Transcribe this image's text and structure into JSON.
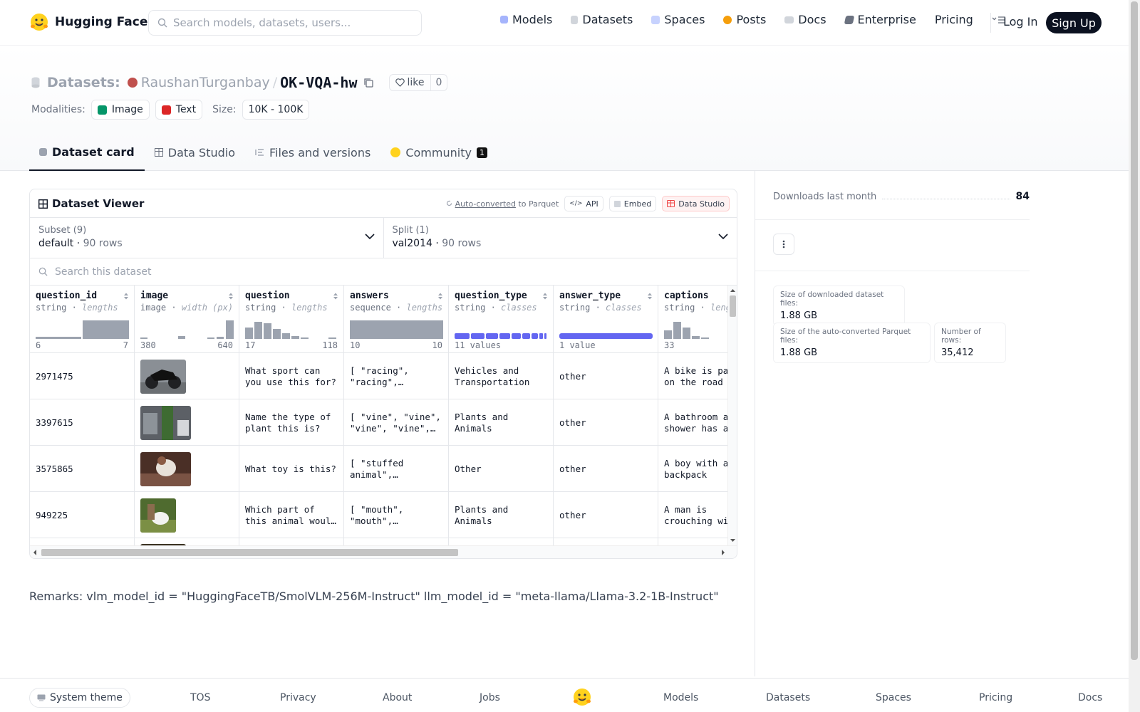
{
  "brand": {
    "name": "Hugging Face"
  },
  "search": {
    "placeholder": "Search models, datasets, users..."
  },
  "nav": {
    "models": "Models",
    "datasets": "Datasets",
    "spaces": "Spaces",
    "posts": "Posts",
    "docs": "Docs",
    "enterprise": "Enterprise",
    "pricing": "Pricing",
    "login": "Log In",
    "signup": "Sign Up"
  },
  "repo": {
    "section": "Datasets:",
    "owner": "RaushanTurganbay",
    "separator": "/",
    "name": "OK-VQA-hw",
    "like_label": "like",
    "like_count": "0"
  },
  "meta": {
    "modalities_label": "Modalities:",
    "image": "Image",
    "text": "Text",
    "size_label": "Size:",
    "size": "10K - 100K"
  },
  "tabs": {
    "card": "Dataset card",
    "studio": "Data Studio",
    "files": "Files and versions",
    "community": "Community",
    "community_count": "1"
  },
  "viewer": {
    "title": "Dataset Viewer",
    "auto_link": "Auto-converted",
    "auto_rest": "to Parquet",
    "api": "API",
    "embed": "Embed",
    "studio": "Data Studio",
    "subset_label": "Subset (9)",
    "subset_value": "default",
    "subset_rows": "90 rows",
    "split_label": "Split (1)",
    "split_value": "val2014",
    "split_rows": "90 rows",
    "search_placeholder": "Search this dataset",
    "columns": [
      {
        "name": "question_id",
        "type": "string",
        "stat": "lengths",
        "min": "6",
        "max": "7"
      },
      {
        "name": "image",
        "type": "image",
        "stat": "width (px)",
        "min": "380",
        "max": "640"
      },
      {
        "name": "question",
        "type": "string",
        "stat": "lengths",
        "min": "17",
        "max": "118"
      },
      {
        "name": "answers",
        "type": "sequence",
        "stat": "lengths",
        "min": "10",
        "max": "10"
      },
      {
        "name": "question_type",
        "type": "string",
        "stat": "classes",
        "min": "11 values",
        "max": ""
      },
      {
        "name": "answer_type",
        "type": "string",
        "stat": "classes",
        "min": "1 value",
        "max": ""
      },
      {
        "name": "captions",
        "type": "string",
        "stat": "lengths",
        "min": "33",
        "max": ""
      }
    ],
    "rows": [
      {
        "question_id": "2971475",
        "question": "What sport can you use this for?",
        "answers": "[ \"racing\", \"racing\",…",
        "question_type": "Vehicles and Transportation",
        "answer_type": "other",
        "captions": "A bike is parked on the road w"
      },
      {
        "question_id": "3397615",
        "question": "Name the type of plant this is?",
        "answers": "[ \"vine\", \"vine\", \"vine\", \"vine\",…",
        "question_type": "Plants and Animals",
        "answer_type": "other",
        "captions": "A bathroom and shower has a"
      },
      {
        "question_id": "3575865",
        "question": "What toy is this?",
        "answers": "[ \"stuffed animal\", \"stuffed…",
        "question_type": "Other",
        "answer_type": "other",
        "captions": "A boy with a bear backpack"
      },
      {
        "question_id": "949225",
        "question": "Which part of this animal would be i…",
        "answers": "[ \"mouth\", \"mouth\", \"mouth\",…",
        "question_type": "Plants and Animals",
        "answer_type": "other",
        "captions": "A man is crouching with a white."
      }
    ]
  },
  "remarks": "Remarks: vlm_model_id = \"HuggingFaceTB/SmolVLM-256M-Instruct\" llm_model_id = \"meta-llama/Llama-3.2-1B-Instruct\"",
  "sidebar": {
    "downloads_label": "Downloads last month",
    "downloads": "84",
    "stat1_label": "Size of downloaded dataset files:",
    "stat1_value": "1.88 GB",
    "stat2_label": "Size of the auto-converted Parquet files:",
    "stat2_value": "1.88 GB",
    "stat3_label": "Number of rows:",
    "stat3_value": "35,412"
  },
  "footer": {
    "theme": "System theme",
    "tos": "TOS",
    "privacy": "Privacy",
    "about": "About",
    "jobs": "Jobs",
    "models": "Models",
    "datasets": "Datasets",
    "spaces": "Spaces",
    "pricing": "Pricing",
    "docs": "Docs"
  },
  "colors": {
    "accent_purple": "#6366f1",
    "bar_gray": "#9ca3af",
    "signup_bg": "#0b1120"
  }
}
